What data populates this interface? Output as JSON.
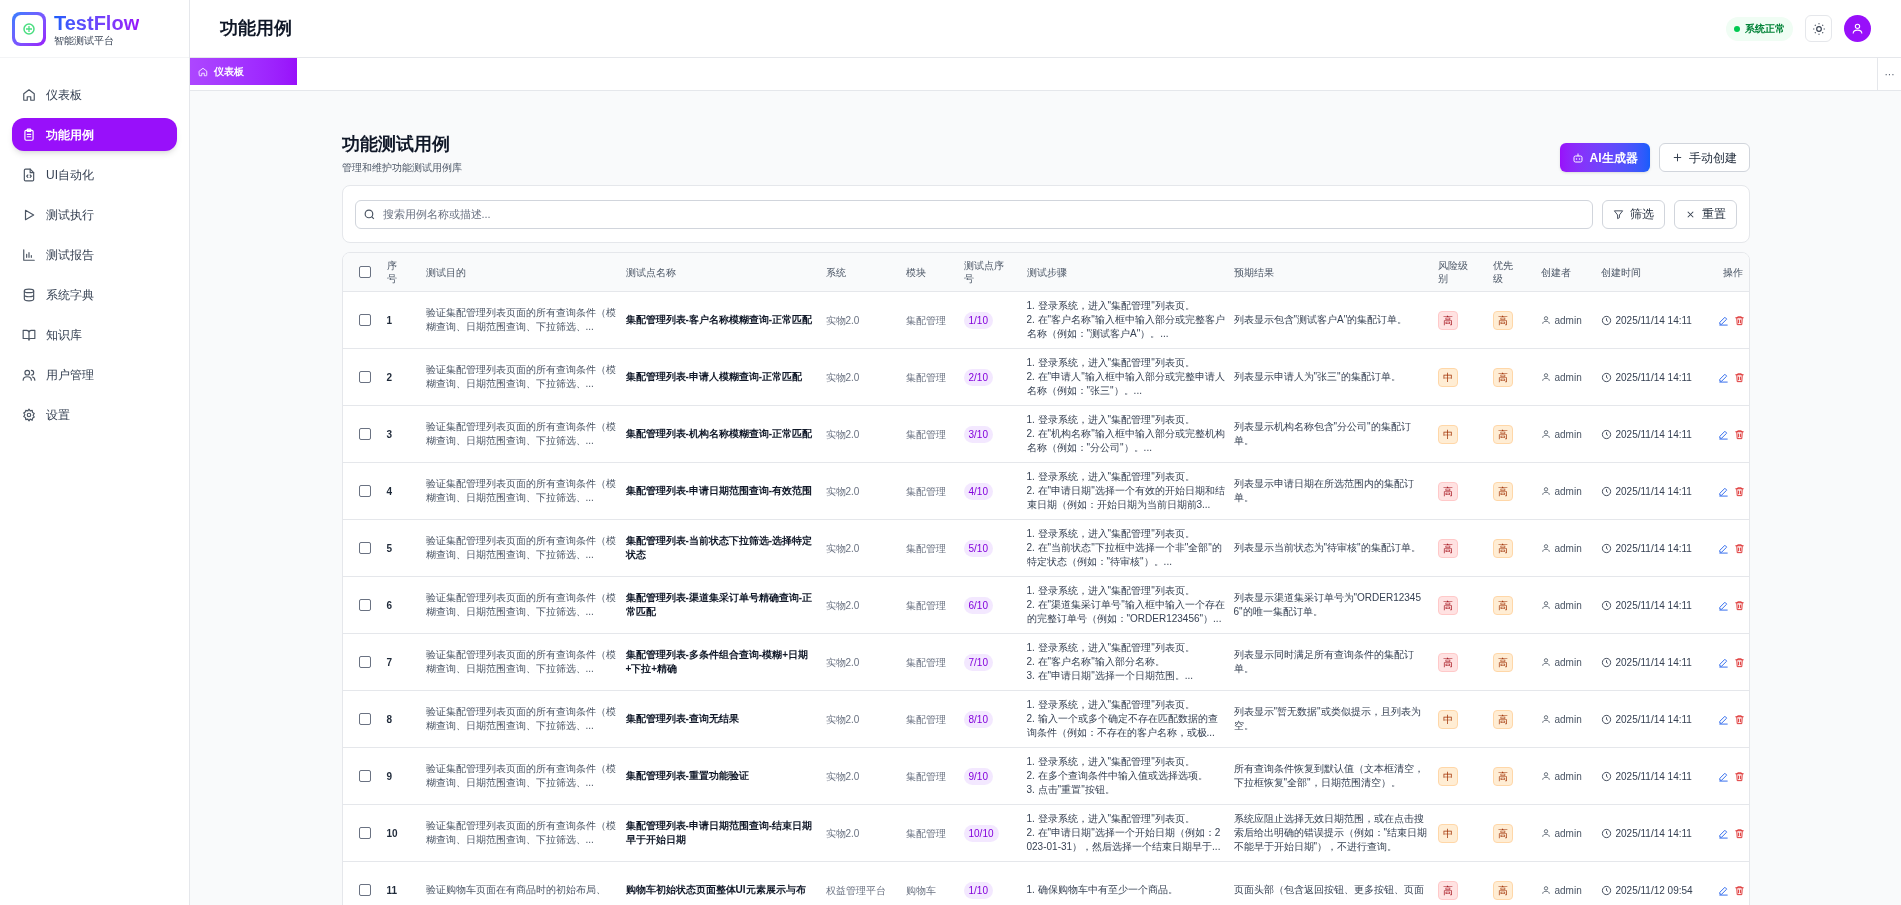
{
  "brand": {
    "name": "TestFlow",
    "subtitle": "智能测试平台"
  },
  "nav": {
    "items": [
      {
        "label": "仪表板",
        "selected": false
      },
      {
        "label": "功能用例",
        "selected": true
      },
      {
        "label": "UI自动化",
        "selected": false
      },
      {
        "label": "测试执行",
        "selected": false
      },
      {
        "label": "测试报告",
        "selected": false
      },
      {
        "label": "系统字典",
        "selected": false
      },
      {
        "label": "知识库",
        "selected": false
      },
      {
        "label": "用户管理",
        "selected": false
      },
      {
        "label": "设置",
        "selected": false
      }
    ]
  },
  "header": {
    "title": "功能用例",
    "status": "系统正常"
  },
  "tabs": [
    {
      "label": "仪表板",
      "selected": true
    }
  ],
  "tab_menu": "···",
  "page": {
    "title": "功能测试用例",
    "subtitle": "管理和维护功能测试用例库",
    "buttons": [
      {
        "kind": "ai",
        "label": "AI生成器"
      },
      {
        "kind": "plus",
        "label": "手动创建"
      }
    ]
  },
  "filter": {
    "placeholder": "搜索用例名称或描述...",
    "buttons": [
      {
        "kind": "filter",
        "label": "筛选"
      },
      {
        "kind": "reset",
        "label": "重置"
      }
    ]
  },
  "table": {
    "select_all": {
      "checked": false
    },
    "columns": [
      "序号",
      "测试目的",
      "测试点名称",
      "系统",
      "模块",
      "测试点序号",
      "测试步骤",
      "预期结果",
      "风险级别",
      "优先级",
      "创建者",
      "创建时间",
      "操作"
    ],
    "rows": [
      {
        "checked": false,
        "no": "1",
        "purpose": "验证集配管理列表页面的所有查询条件（模糊查询、日期范围查询、下拉筛选、...",
        "name": "集配管理列表-客户名称模糊查询-正常匹配",
        "system": "实物2.0",
        "module": "集配管理",
        "point": "1/10",
        "steps": "1. 登录系统，进入\"集配管理\"列表页。\n2. 在\"客户名称\"输入框中输入部分或完整客户名称（例如：\"测试客户A\"）。...",
        "expected": "列表显示包含\"测试客户A\"的集配订单。",
        "risk": {
          "text": "高",
          "kind": "high"
        },
        "priority": {
          "text": "高",
          "kind": "medium"
        },
        "creator": "admin",
        "created": "2025/11/14 14:11"
      },
      {
        "checked": false,
        "no": "2",
        "purpose": "验证集配管理列表页面的所有查询条件（模糊查询、日期范围查询、下拉筛选、...",
        "name": "集配管理列表-申请人模糊查询-正常匹配",
        "system": "实物2.0",
        "module": "集配管理",
        "point": "2/10",
        "steps": "1. 登录系统，进入\"集配管理\"列表页。\n2. 在\"申请人\"输入框中输入部分或完整申请人名称（例如：\"张三\"）。...",
        "expected": "列表显示申请人为\"张三\"的集配订单。",
        "risk": {
          "text": "中",
          "kind": "medium"
        },
        "priority": {
          "text": "高",
          "kind": "medium"
        },
        "creator": "admin",
        "created": "2025/11/14 14:11"
      },
      {
        "checked": false,
        "no": "3",
        "purpose": "验证集配管理列表页面的所有查询条件（模糊查询、日期范围查询、下拉筛选、...",
        "name": "集配管理列表-机构名称模糊查询-正常匹配",
        "system": "实物2.0",
        "module": "集配管理",
        "point": "3/10",
        "steps": "1. 登录系统，进入\"集配管理\"列表页。\n2. 在\"机构名称\"输入框中输入部分或完整机构名称（例如：\"分公司\"）。...",
        "expected": "列表显示机构名称包含\"分公司\"的集配订单。",
        "risk": {
          "text": "中",
          "kind": "medium"
        },
        "priority": {
          "text": "高",
          "kind": "medium"
        },
        "creator": "admin",
        "created": "2025/11/14 14:11"
      },
      {
        "checked": false,
        "no": "4",
        "purpose": "验证集配管理列表页面的所有查询条件（模糊查询、日期范围查询、下拉筛选、...",
        "name": "集配管理列表-申请日期范围查询-有效范围",
        "system": "实物2.0",
        "module": "集配管理",
        "point": "4/10",
        "steps": "1. 登录系统，进入\"集配管理\"列表页。\n2. 在\"申请日期\"选择一个有效的开始日期和结束日期（例如：开始日期为当前日期前3...",
        "expected": "列表显示申请日期在所选范围内的集配订单。",
        "risk": {
          "text": "高",
          "kind": "high"
        },
        "priority": {
          "text": "高",
          "kind": "medium"
        },
        "creator": "admin",
        "created": "2025/11/14 14:11"
      },
      {
        "checked": false,
        "no": "5",
        "purpose": "验证集配管理列表页面的所有查询条件（模糊查询、日期范围查询、下拉筛选、...",
        "name": "集配管理列表-当前状态下拉筛选-选择特定状态",
        "system": "实物2.0",
        "module": "集配管理",
        "point": "5/10",
        "steps": "1. 登录系统，进入\"集配管理\"列表页。\n2. 在\"当前状态\"下拉框中选择一个非\"全部\"的特定状态（例如：\"待审核\"）。...",
        "expected": "列表显示当前状态为\"待审核\"的集配订单。",
        "risk": {
          "text": "高",
          "kind": "high"
        },
        "priority": {
          "text": "高",
          "kind": "medium"
        },
        "creator": "admin",
        "created": "2025/11/14 14:11"
      },
      {
        "checked": false,
        "no": "6",
        "purpose": "验证集配管理列表页面的所有查询条件（模糊查询、日期范围查询、下拉筛选、...",
        "name": "集配管理列表-渠道集采订单号精确查询-正常匹配",
        "system": "实物2.0",
        "module": "集配管理",
        "point": "6/10",
        "steps": "1. 登录系统，进入\"集配管理\"列表页。\n2. 在\"渠道集采订单号\"输入框中输入一个存在的完整订单号（例如：\"ORDER123456\"）...",
        "expected": "列表显示渠道集采订单号为\"ORDER123456\"的唯一集配订单。",
        "risk": {
          "text": "高",
          "kind": "high"
        },
        "priority": {
          "text": "高",
          "kind": "medium"
        },
        "creator": "admin",
        "created": "2025/11/14 14:11"
      },
      {
        "checked": false,
        "no": "7",
        "purpose": "验证集配管理列表页面的所有查询条件（模糊查询、日期范围查询、下拉筛选、...",
        "name": "集配管理列表-多条件组合查询-模糊+日期+下拉+精确",
        "system": "实物2.0",
        "module": "集配管理",
        "point": "7/10",
        "steps": "1. 登录系统，进入\"集配管理\"列表页。\n2. 在\"客户名称\"输入部分名称。\n3. 在\"申请日期\"选择一个日期范围。...",
        "expected": "列表显示同时满足所有查询条件的集配订单。",
        "risk": {
          "text": "高",
          "kind": "high"
        },
        "priority": {
          "text": "高",
          "kind": "medium"
        },
        "creator": "admin",
        "created": "2025/11/14 14:11"
      },
      {
        "checked": false,
        "no": "8",
        "purpose": "验证集配管理列表页面的所有查询条件（模糊查询、日期范围查询、下拉筛选、...",
        "name": "集配管理列表-查询无结果",
        "system": "实物2.0",
        "module": "集配管理",
        "point": "8/10",
        "steps": "1. 登录系统，进入\"集配管理\"列表页。\n2. 输入一个或多个确定不存在匹配数据的查询条件（例如：不存在的客户名称，或极...",
        "expected": "列表显示\"暂无数据\"或类似提示，且列表为空。",
        "risk": {
          "text": "中",
          "kind": "medium"
        },
        "priority": {
          "text": "高",
          "kind": "medium"
        },
        "creator": "admin",
        "created": "2025/11/14 14:11"
      },
      {
        "checked": false,
        "no": "9",
        "purpose": "验证集配管理列表页面的所有查询条件（模糊查询、日期范围查询、下拉筛选、...",
        "name": "集配管理列表-重置功能验证",
        "system": "实物2.0",
        "module": "集配管理",
        "point": "9/10",
        "steps": "1. 登录系统，进入\"集配管理\"列表页。\n2. 在多个查询条件中输入值或选择选项。\n3. 点击\"重置\"按钮。",
        "expected": "所有查询条件恢复到默认值（文本框清空，下拉框恢复\"全部\"，日期范围清空）。",
        "risk": {
          "text": "中",
          "kind": "medium"
        },
        "priority": {
          "text": "高",
          "kind": "medium"
        },
        "creator": "admin",
        "created": "2025/11/14 14:11"
      },
      {
        "checked": false,
        "no": "10",
        "purpose": "验证集配管理列表页面的所有查询条件（模糊查询、日期范围查询、下拉筛选、...",
        "name": "集配管理列表-申请日期范围查询-结束日期早于开始日期",
        "system": "实物2.0",
        "module": "集配管理",
        "point": "10/10",
        "steps": "1. 登录系统，进入\"集配管理\"列表页。\n2. 在\"申请日期\"选择一个开始日期（例如：2023-01-31），然后选择一个结束日期早于...",
        "expected": "系统应阻止选择无效日期范围，或在点击搜索后给出明确的错误提示（例如：\"结束日期不能早于开始日期\"），不进行查询。",
        "risk": {
          "text": "中",
          "kind": "medium"
        },
        "priority": {
          "text": "高",
          "kind": "medium"
        },
        "creator": "admin",
        "created": "2025/11/14 14:11"
      },
      {
        "checked": false,
        "no": "11",
        "purpose": "验证购物车页面在有商品时的初始布局、",
        "name": "购物车初始状态页面整体UI元素展示与布",
        "system": "权益管理平台",
        "module": "购物车",
        "point": "1/10",
        "steps": "1. 确保购物车中有至少一个商品。",
        "expected": "页面头部（包含返回按钮、更多按钮、页面",
        "risk": {
          "text": "高",
          "kind": "high"
        },
        "priority": {
          "text": "高",
          "kind": "medium"
        },
        "creator": "admin",
        "created": "2025/11/12 09:54"
      }
    ]
  }
}
